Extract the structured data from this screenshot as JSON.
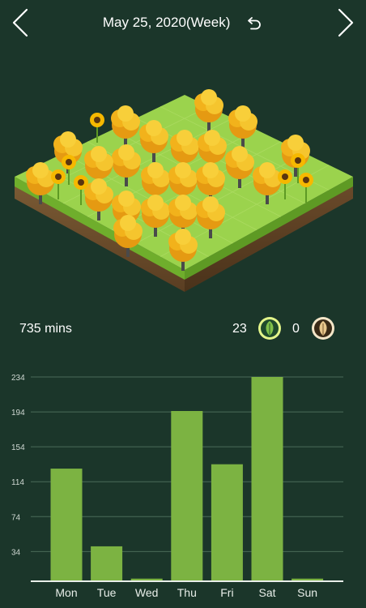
{
  "header": {
    "title": "May 25, 2020(Week)",
    "prev_icon": "chevron-left-icon",
    "next_icon": "chevron-right-icon",
    "reset_icon": "undo-icon"
  },
  "stats": {
    "total_time": "735 mins",
    "healthy_count": "23",
    "dead_count": "0",
    "healthy_icon": "leaf-icon",
    "dead_icon": "withered-leaf-icon"
  },
  "colors": {
    "background": "#1b362a",
    "bar": "#7cb342",
    "grid": "#4b6b59"
  },
  "chart_data": {
    "type": "bar",
    "categories": [
      "Mon",
      "Tue",
      "Wed",
      "Thu",
      "Fri",
      "Sat",
      "Sun"
    ],
    "values": [
      129,
      40,
      3,
      195,
      134,
      234,
      3
    ],
    "yticks": [
      34,
      74,
      114,
      154,
      194,
      234
    ],
    "ylim": [
      0,
      234
    ],
    "grid": true
  }
}
